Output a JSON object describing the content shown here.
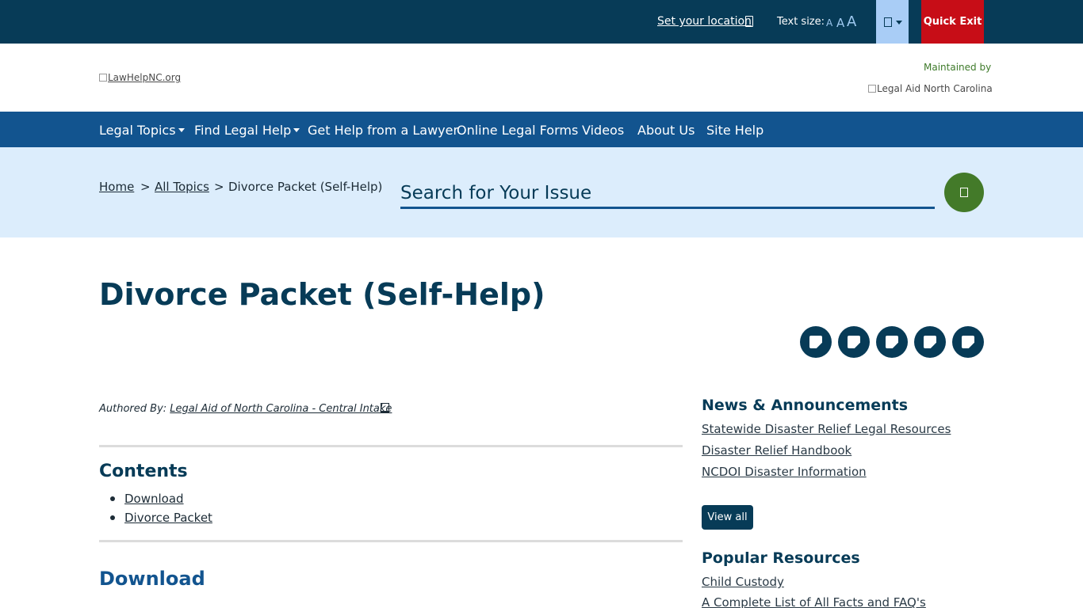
{
  "topbar": {
    "location_link": "Set your location",
    "text_size_label": "Text size:",
    "text_size_small": "A",
    "text_size_medium": "A",
    "text_size_large": "A",
    "quick_exit": "Quick Exit"
  },
  "header": {
    "site_logo_alt": "LawHelpNC.org",
    "maintained_by": "Maintained by",
    "partner_logo_alt": "Legal Aid North Carolina"
  },
  "nav": {
    "items": [
      {
        "label": "Legal Topics",
        "dropdown": true
      },
      {
        "label": "Find Legal Help",
        "dropdown": true
      },
      {
        "label": "Get Help from a Lawyer",
        "dropdown": false
      },
      {
        "label": "Online Legal Forms",
        "dropdown": false
      },
      {
        "label": "Videos",
        "dropdown": false
      },
      {
        "label": "About Us",
        "dropdown": false
      },
      {
        "label": "Site Help",
        "dropdown": false
      }
    ]
  },
  "breadcrumb": {
    "home": "Home",
    "sep": ">",
    "all_topics": "All Topics",
    "current": "Divorce Packet (Self-Help)"
  },
  "search": {
    "placeholder": "Search for Your Issue"
  },
  "page": {
    "title": "Divorce Packet (Self-Help)",
    "authored_by_label": "Authored By:",
    "author": "Legal Aid of North Carolina - Central Intake",
    "contents_heading": "Contents",
    "toc": [
      "Download",
      "Divorce Packet"
    ],
    "download_heading": "Download"
  },
  "sidebar": {
    "news_heading": "News & Announcements",
    "news_links": [
      "Statewide Disaster Relief Legal Resources",
      "Disaster Relief Handbook",
      "NCDOI Disaster Information"
    ],
    "view_all": "View all",
    "popular_heading": "Popular Resources",
    "popular_links": [
      "Child Custody",
      "A Complete List of All Facts and FAQ's"
    ]
  },
  "colors": {
    "topbar": "#073b57",
    "nav": "#12548f",
    "band": "#dcedfc",
    "quick_exit": "#c70d17",
    "search_button": "#437a29"
  }
}
